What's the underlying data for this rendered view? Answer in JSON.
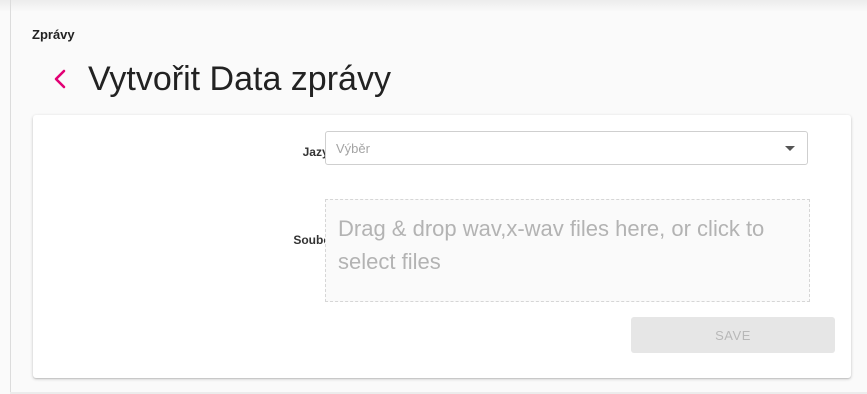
{
  "breadcrumb": "Zprávy",
  "header": {
    "title": "Vytvořit Data zprávy",
    "back_icon": "chevron-left-icon"
  },
  "form": {
    "language": {
      "label": "Jazyk",
      "required_mark": "*",
      "placeholder": "Výběr"
    },
    "file": {
      "label": "Soubor",
      "required_mark": "*",
      "dropzone_text": "Drag & drop wav,x-wav files here, or click to select files"
    },
    "save_label": "SAVE"
  },
  "colors": {
    "accent": "#e20074",
    "text": "#222222",
    "placeholder": "#a4a4a4",
    "button_disabled_bg": "#e6e6e6"
  }
}
